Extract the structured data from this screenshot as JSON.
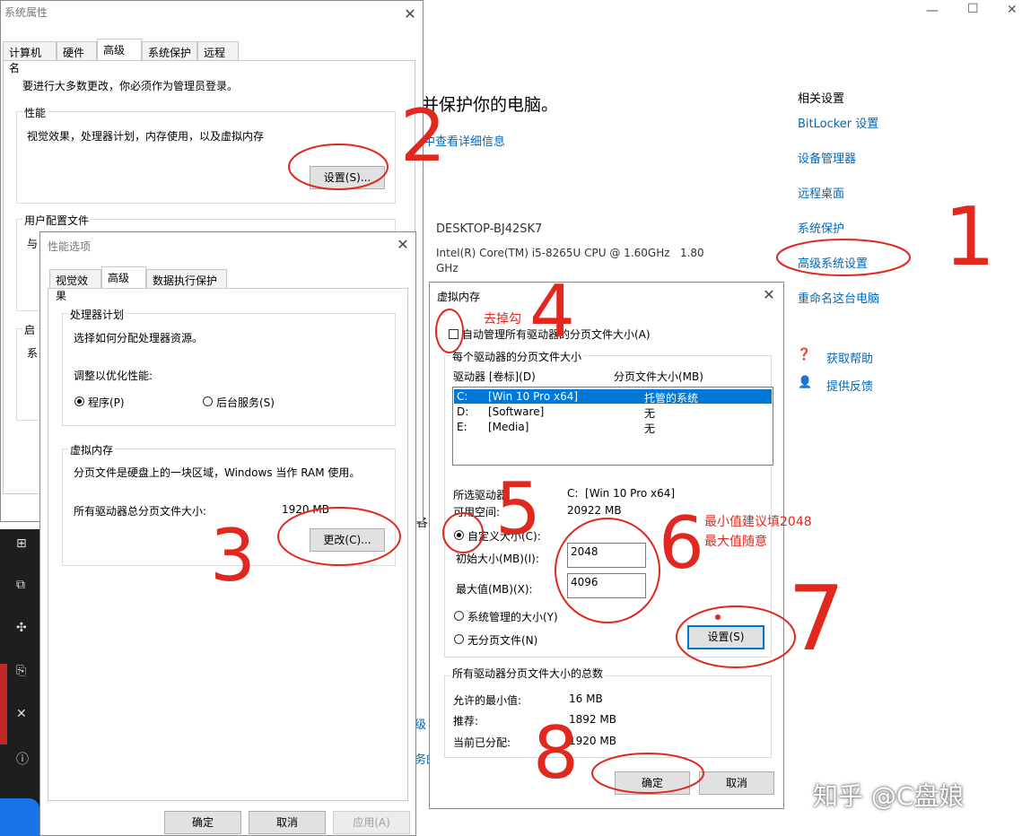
{
  "settings_window": {
    "header_text": "并保护你的电脑。",
    "details_link": "中查看详细信息",
    "device_name": "DESKTOP-BJ42SK7",
    "processor": "Intel(R) Core(TM) i5-8265U CPU @ 1.60GHz   1.80",
    "processor_line2": "GHz",
    "related_title": "相关设置",
    "related_links": [
      "BitLocker 设置",
      "设备管理器",
      "远程桌面",
      "系统保护",
      "高级系统设置",
      "重命名这台电脑"
    ],
    "help_items": [
      "获取帮助",
      "提供反馈"
    ],
    "partial_texts": [
      "级",
      "务的",
      "各"
    ],
    "window_controls": {
      "minimize": "—",
      "maximize": "☐",
      "close": "✕"
    }
  },
  "system_properties": {
    "title": "系统属性",
    "tabs": [
      "计算机名",
      "硬件",
      "高级",
      "系统保护",
      "远程"
    ],
    "admin_note": "要进行大多数更改，你必须作为管理员登录。",
    "performance": {
      "label": "性能",
      "desc": "视觉效果，处理器计划，内存使用，以及虚拟内存",
      "button": "设置(S)..."
    },
    "user_profile": {
      "label": "用户配置文件",
      "desc_partial": "与"
    },
    "startup": {
      "label_partial": "启",
      "desc_partial": "系"
    }
  },
  "performance_options": {
    "title": "性能选项",
    "tabs": [
      "视觉效果",
      "高级",
      "数据执行保护"
    ],
    "cpu_group": {
      "label": "处理器计划",
      "desc": "选择如何分配处理器资源。",
      "adjust_label": "调整以优化性能:",
      "option_programs": "程序(P)",
      "option_background": "后台服务(S)"
    },
    "vm_group": {
      "label": "虚拟内存",
      "desc": "分页文件是硬盘上的一块区域，Windows 当作 RAM 使用。",
      "total_label": "所有驱动器总分页文件大小:",
      "total_value": "1920 MB",
      "change_button": "更改(C)..."
    },
    "buttons": {
      "ok": "确定",
      "cancel": "取消",
      "apply": "应用(A)"
    }
  },
  "virtual_memory": {
    "title": "虚拟内存",
    "auto_manage": "自动管理所有驱动器的分页文件大小(A)",
    "per_drive_label": "每个驱动器的分页文件大小",
    "col_drive": "驱动器 [卷标](D)",
    "col_size": "分页文件大小(MB)",
    "drives": [
      {
        "letter": "C:",
        "label": "[Win 10 Pro x64]",
        "size": "托管的系统"
      },
      {
        "letter": "D:",
        "label": "[Software]",
        "size": "无"
      },
      {
        "letter": "E:",
        "label": "[Media]",
        "size": "无"
      }
    ],
    "selected_drive_label": "所选驱动器:",
    "selected_drive_value": "C:  [Win 10 Pro x64]",
    "free_space_label": "可用空间:",
    "free_space_value": "20922 MB",
    "custom_size": "自定义大小(C):",
    "initial_label": "初始大小(MB)(I):",
    "initial_value": "2048",
    "max_label": "最大值(MB)(X):",
    "max_value": "4096",
    "system_managed": "系统管理的大小(Y)",
    "no_paging": "无分页文件(N)",
    "set_button": "设置(S)",
    "totals_label": "所有驱动器分页文件大小的总数",
    "min_allowed_label": "允许的最小值:",
    "min_allowed_value": "16 MB",
    "recommended_label": "推荐:",
    "recommended_value": "1892 MB",
    "current_label": "当前已分配:",
    "current_value": "1920 MB",
    "ok": "确定",
    "cancel": "取消"
  },
  "annotations": {
    "uncheck_note": "去掉勾",
    "size_note_1": "最小值建议填2048",
    "size_note_2": "最大值随意",
    "step_numbers": [
      "1",
      "2",
      "3",
      "4",
      "5",
      "6",
      "7",
      "8"
    ]
  },
  "watermark": "知乎 @C盘娘",
  "colors": {
    "annotation_red": "#e0281e",
    "selection_blue": "#0078d7",
    "link_blue": "#0067b8"
  }
}
